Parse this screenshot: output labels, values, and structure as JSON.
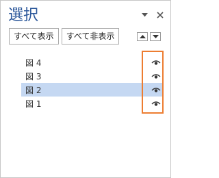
{
  "pane": {
    "title": "選択",
    "icons": {
      "dropdown": "chevron-down-icon",
      "close": "close-icon"
    }
  },
  "toolbar": {
    "show_all_label": "すべて表示",
    "hide_all_label": "すべて非表示",
    "bring_forward_icon": "arrow-up-icon",
    "send_backward_icon": "arrow-down-icon"
  },
  "shapes": [
    {
      "name": "図 4",
      "visible": true,
      "selected": false
    },
    {
      "name": "図 3",
      "visible": true,
      "selected": false
    },
    {
      "name": "図 2",
      "visible": true,
      "selected": true
    },
    {
      "name": "図 1",
      "visible": true,
      "selected": false
    }
  ],
  "colors": {
    "title": "#2b579a",
    "selection": "#c5d8f2",
    "highlight_box": "#ed7d31"
  }
}
